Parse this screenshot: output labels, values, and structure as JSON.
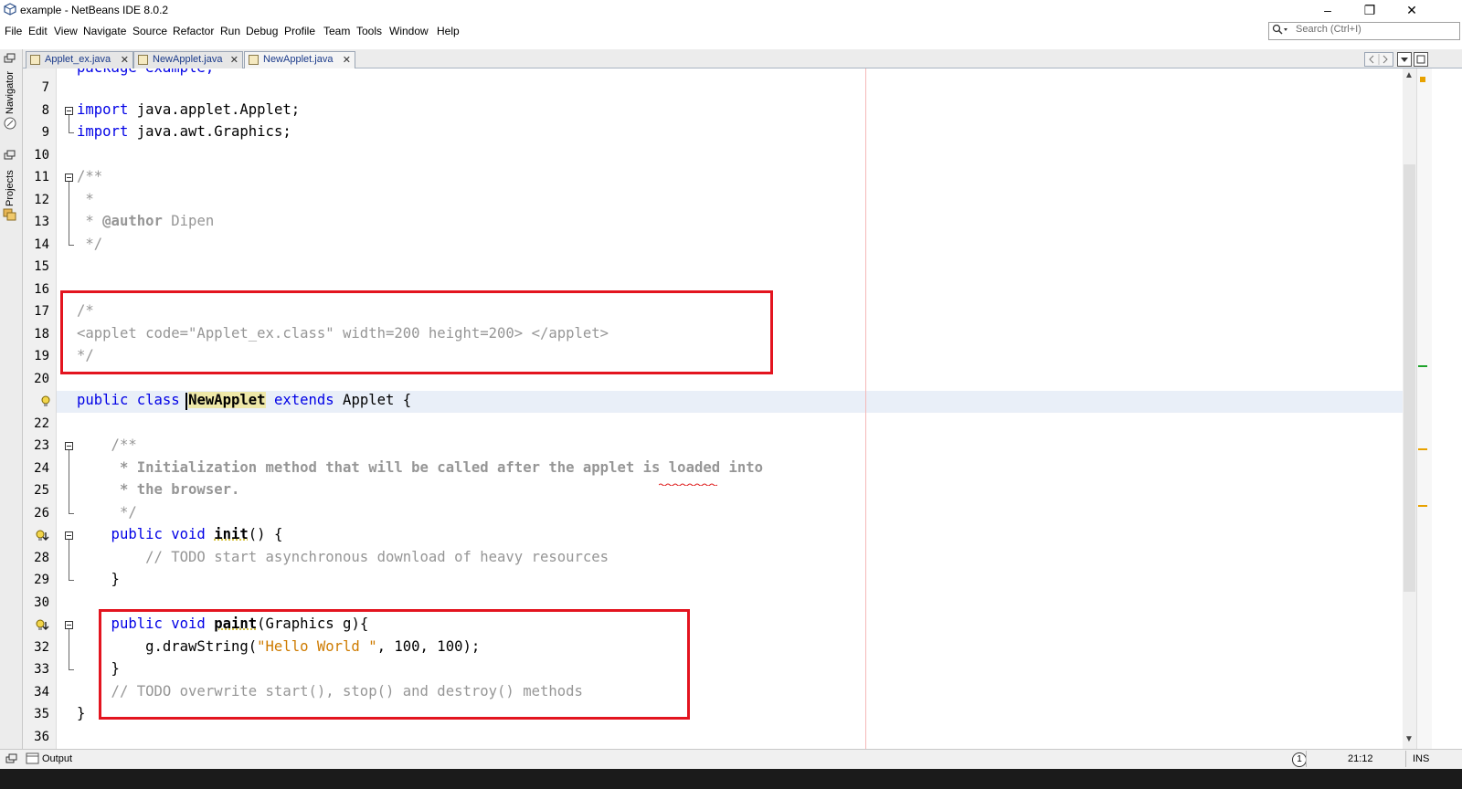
{
  "window": {
    "title": "example - NetBeans IDE 8.0.2"
  },
  "menu": [
    "File",
    "Edit",
    "View",
    "Navigate",
    "Source",
    "Refactor",
    "Run",
    "Debug",
    "Profile",
    "Team",
    "Tools",
    "Window",
    "Help"
  ],
  "search": {
    "placeholder": "Search (Ctrl+I)"
  },
  "side_panels": [
    "Navigator",
    "Projects"
  ],
  "tabs": [
    {
      "label": "Applet_ex.java",
      "active": false
    },
    {
      "label": "NewApplet.java",
      "active": false
    },
    {
      "label": "NewApplet.java",
      "active": true
    }
  ],
  "editor": {
    "lines": [
      {
        "n": "7",
        "segs": []
      },
      {
        "n": "8",
        "segs": [
          {
            "t": "import",
            "c": "kw"
          },
          {
            "t": " java.applet.Applet;",
            "c": ""
          }
        ]
      },
      {
        "n": "9",
        "segs": [
          {
            "t": "import",
            "c": "kw"
          },
          {
            "t": " java.awt.Graphics;",
            "c": ""
          }
        ]
      },
      {
        "n": "10",
        "segs": []
      },
      {
        "n": "11",
        "segs": [
          {
            "t": "/**",
            "c": "cm"
          }
        ]
      },
      {
        "n": "12",
        "segs": [
          {
            "t": " *",
            "c": "cm"
          }
        ]
      },
      {
        "n": "13",
        "segs": [
          {
            "t": " * ",
            "c": "cm"
          },
          {
            "t": "@author",
            "c": "cm bold"
          },
          {
            "t": " Dipen",
            "c": "cm"
          }
        ]
      },
      {
        "n": "14",
        "segs": [
          {
            "t": " */",
            "c": "cm"
          }
        ]
      },
      {
        "n": "15",
        "segs": []
      },
      {
        "n": "16",
        "segs": []
      },
      {
        "n": "17",
        "segs": [
          {
            "t": "/*",
            "c": "cm"
          }
        ]
      },
      {
        "n": "18",
        "segs": [
          {
            "t": "<applet code=\"Applet_ex.class\" width=200 height=200> </applet>",
            "c": "cm"
          }
        ]
      },
      {
        "n": "19",
        "segs": [
          {
            "t": "*/",
            "c": "cm"
          }
        ]
      },
      {
        "n": "20",
        "segs": []
      },
      {
        "n": "",
        "segs": [
          {
            "t": "public class ",
            "c": "kw"
          },
          {
            "t": "NewApplet",
            "c": "bold"
          },
          {
            "t": " extends",
            "c": "kw"
          },
          {
            "t": " Applet {",
            "c": ""
          }
        ]
      },
      {
        "n": "22",
        "segs": []
      },
      {
        "n": "23",
        "segs": [
          {
            "t": "    /**",
            "c": "cm"
          }
        ]
      },
      {
        "n": "24",
        "segs": [
          {
            "t": "     * Initialization method that will be called after the applet is loaded into",
            "c": "cm bold"
          }
        ]
      },
      {
        "n": "25",
        "segs": [
          {
            "t": "     * the browser.",
            "c": "cm bold"
          }
        ]
      },
      {
        "n": "26",
        "segs": [
          {
            "t": "     */",
            "c": "cm"
          }
        ]
      },
      {
        "n": "",
        "segs": [
          {
            "t": "    public void ",
            "c": "kw"
          },
          {
            "t": "init",
            "c": "bold"
          },
          {
            "t": "() {",
            "c": ""
          }
        ]
      },
      {
        "n": "28",
        "segs": [
          {
            "t": "        // TODO start asynchronous download of heavy resources",
            "c": "cm"
          }
        ]
      },
      {
        "n": "29",
        "segs": [
          {
            "t": "    }",
            "c": ""
          }
        ]
      },
      {
        "n": "30",
        "segs": []
      },
      {
        "n": "",
        "segs": [
          {
            "t": "    public void ",
            "c": "kw"
          },
          {
            "t": "paint",
            "c": "bold"
          },
          {
            "t": "(Graphics g){",
            "c": ""
          }
        ]
      },
      {
        "n": "32",
        "segs": [
          {
            "t": "        g.drawString(",
            "c": ""
          },
          {
            "t": "\"Hello World \"",
            "c": "str"
          },
          {
            "t": ", 100, 100);",
            "c": ""
          }
        ]
      },
      {
        "n": "33",
        "segs": [
          {
            "t": "    }",
            "c": ""
          }
        ]
      },
      {
        "n": "34",
        "segs": [
          {
            "t": "    // TODO overwrite start(), stop() and destroy() methods",
            "c": "cm"
          }
        ]
      },
      {
        "n": "35",
        "segs": [
          {
            "t": "}",
            "c": ""
          }
        ]
      },
      {
        "n": "36",
        "segs": []
      }
    ]
  },
  "status": {
    "output_label": "Output",
    "notifications": "1",
    "position": "21:12",
    "mode": "INS"
  }
}
